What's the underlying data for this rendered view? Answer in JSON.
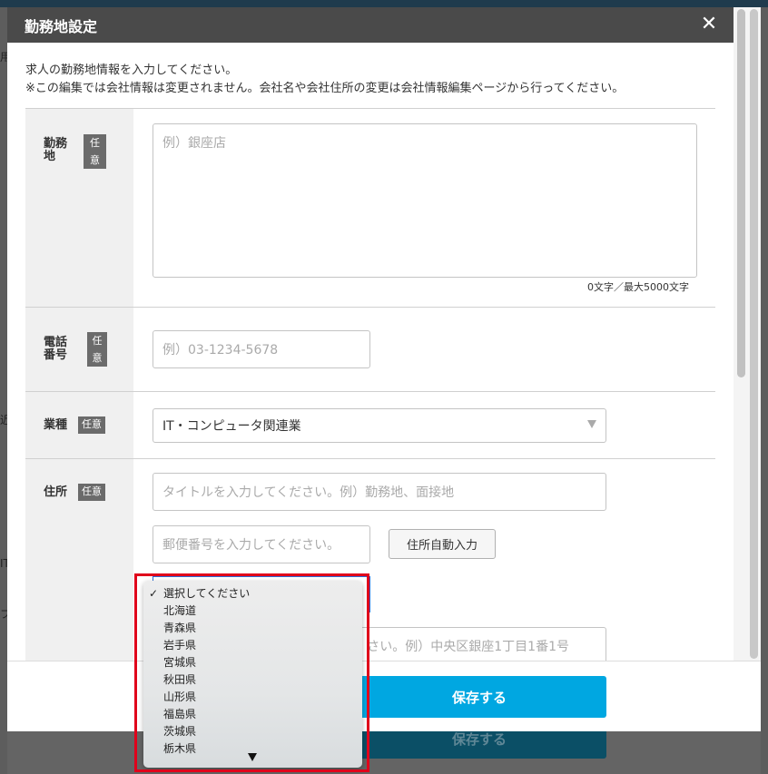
{
  "background": {
    "left_char_1": "用",
    "left_char_2": "近",
    "left_char_3": "IT",
    "left_char_4": "フ",
    "save_label": "保存する"
  },
  "modal": {
    "title": "勤務地設定",
    "close": "✕",
    "intro_line1": "求人の勤務地情報を入力してください。",
    "intro_line2": "※この編集では会社情報は変更されません。会社名や会社住所の変更は会社情報編集ページから行ってください。"
  },
  "fields": {
    "location": {
      "label_line1": "勤務",
      "label_line2": "地",
      "badge_line1": "任",
      "badge_line2": "意",
      "placeholder": "例）銀座店",
      "counter": "0文字／最大5000文字"
    },
    "phone": {
      "label_line1": "電話",
      "label_line2": "番号",
      "badge_line1": "任",
      "badge_line2": "意",
      "placeholder": "例）03-1234-5678"
    },
    "industry": {
      "label": "業種",
      "badge": "任意",
      "value": "IT・コンピュータ関連業"
    },
    "address": {
      "label": "住所",
      "badge": "任意",
      "title_placeholder": "タイトルを入力してください。例）勤務地、面接地",
      "zip_placeholder": "郵便番号を入力してください。",
      "auto_button": "住所自動入力",
      "street_placeholder": "さい。例）中央区銀座1丁目1番1号"
    }
  },
  "footer": {
    "save_label": "保存する"
  },
  "dropdown": {
    "checkmark": "✓",
    "options": [
      "選択してください",
      "北海道",
      "青森県",
      "岩手県",
      "宮城県",
      "秋田県",
      "山形県",
      "福島県",
      "茨城県",
      "栃木県"
    ]
  },
  "colors": {
    "accent": "#00a7e1",
    "highlight": "#e0001b",
    "header": "#4a4a4a"
  }
}
